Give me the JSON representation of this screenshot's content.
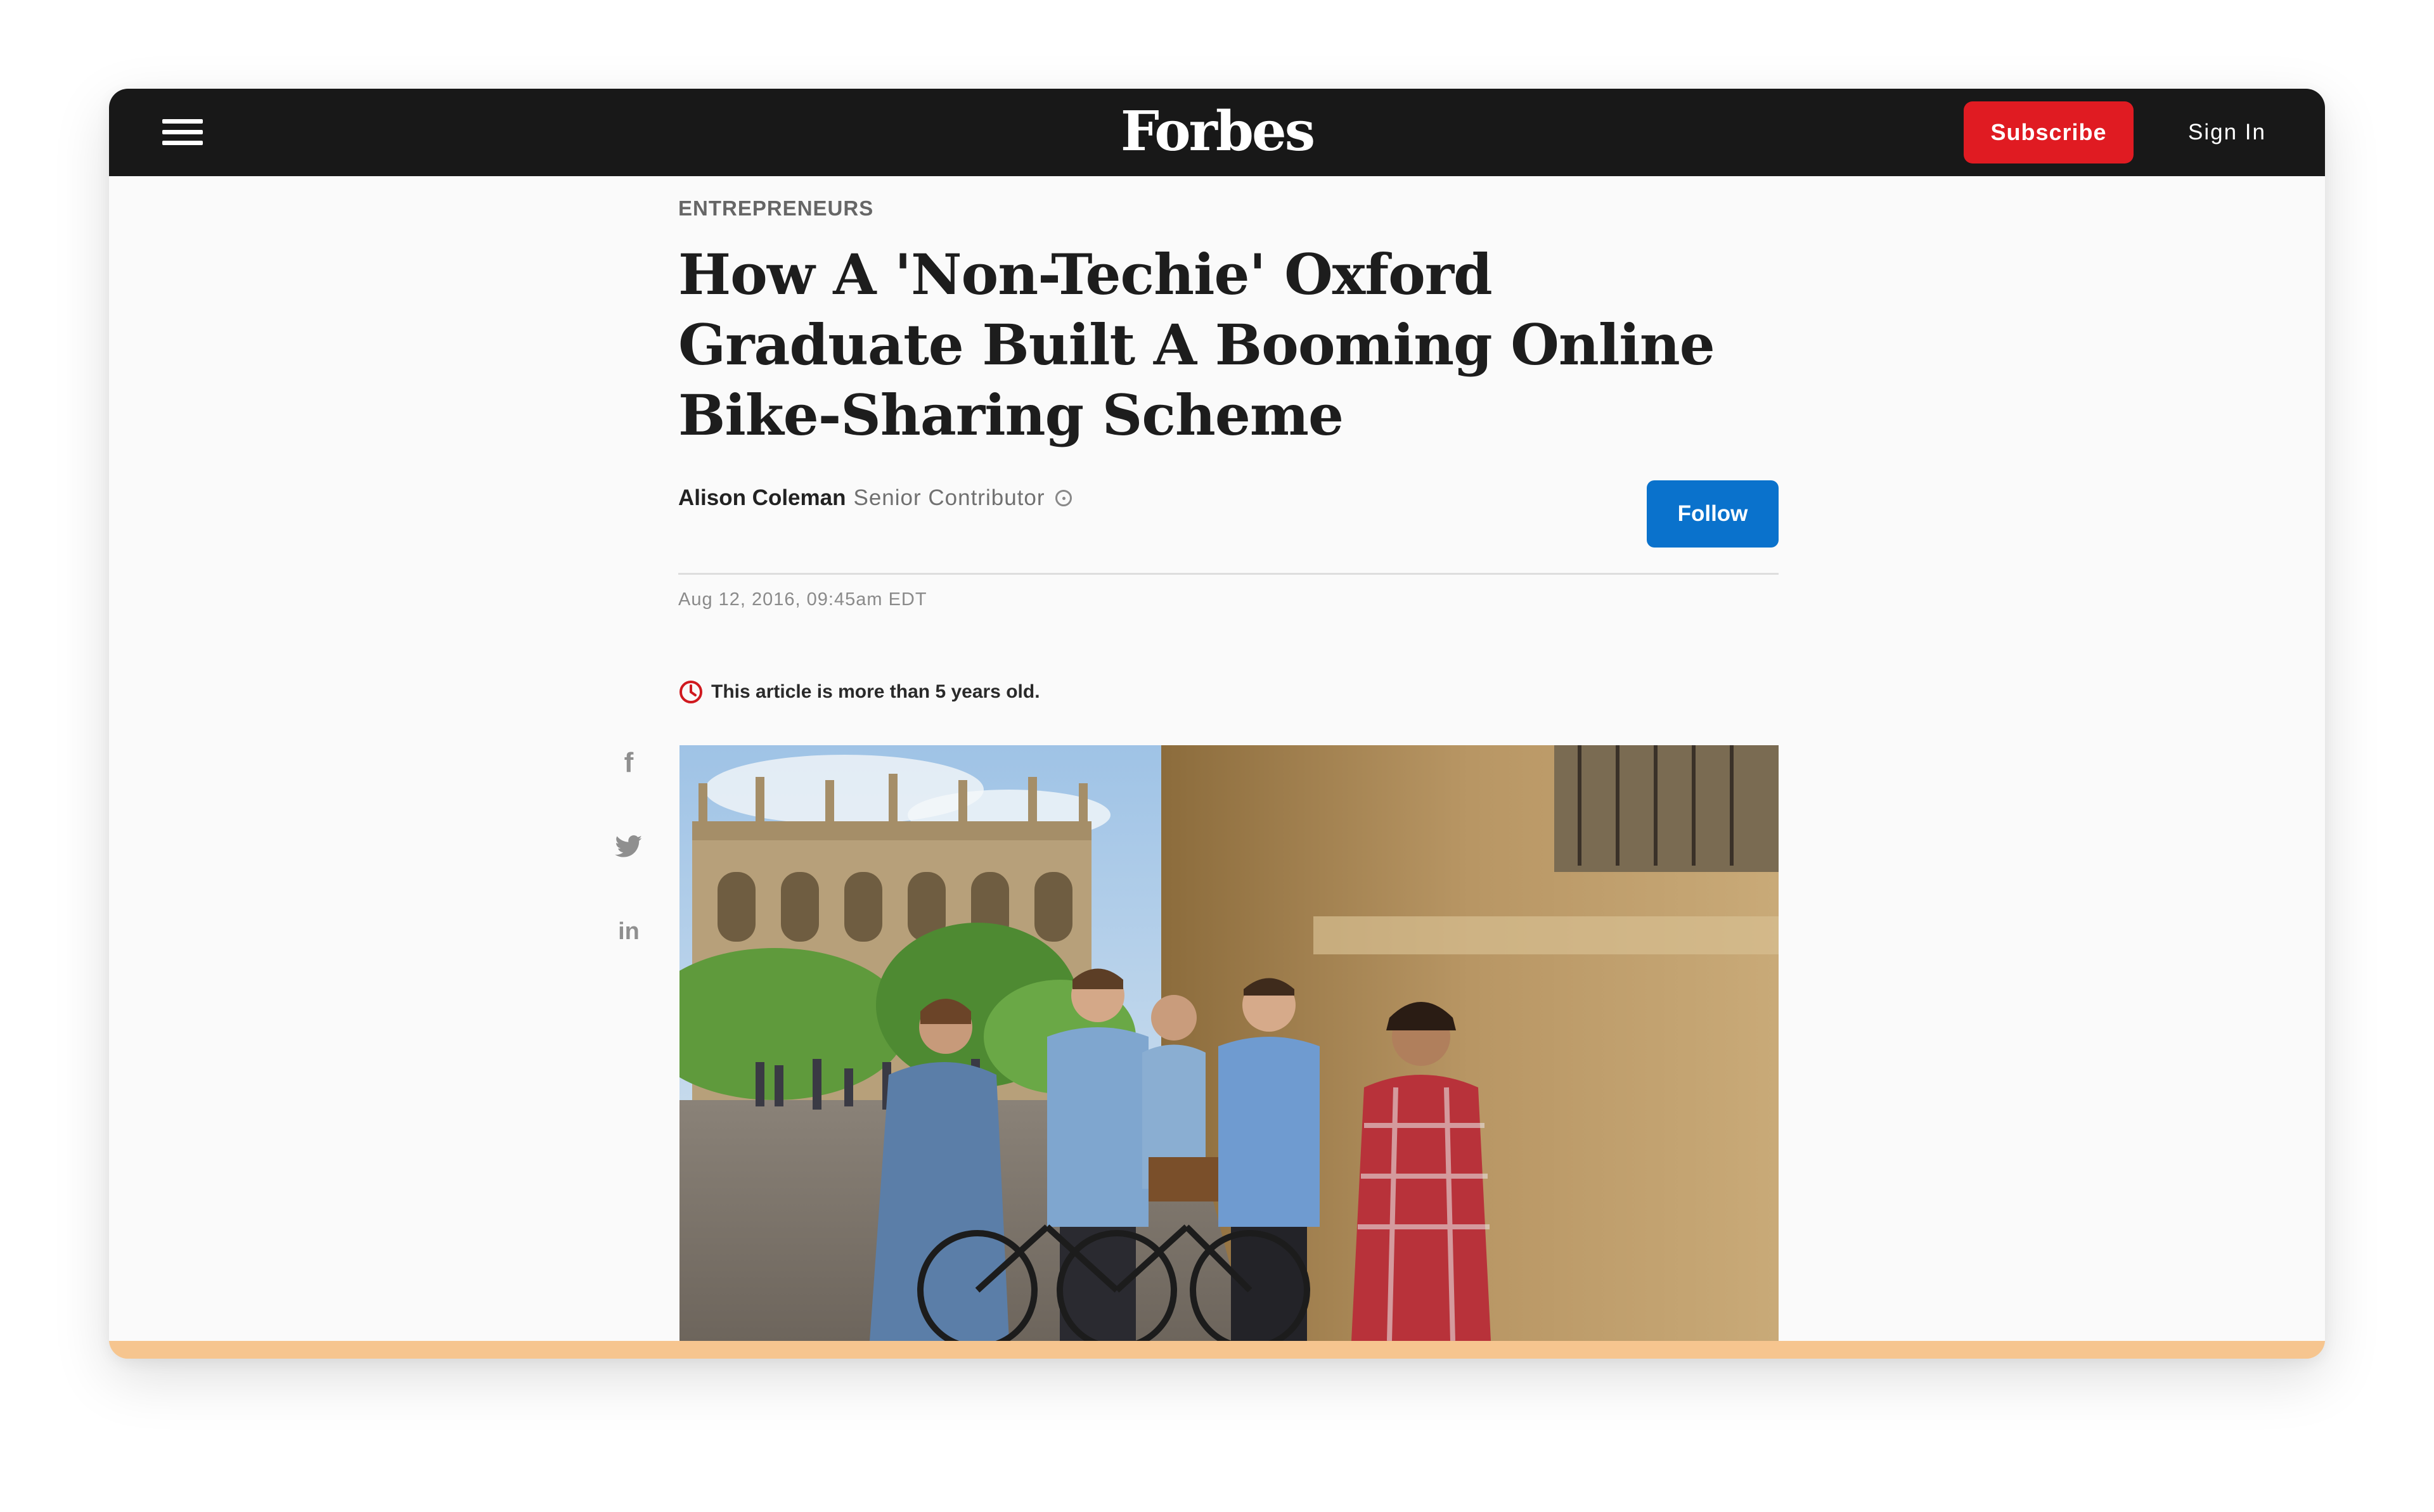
{
  "header": {
    "logo": "Forbes",
    "subscribe_label": "Subscribe",
    "signin_label": "Sign In"
  },
  "article": {
    "category": "ENTREPRENEURS",
    "headline": "How A 'Non-Techie' Oxford Graduate Built A Booming Online Bike-Sharing Scheme",
    "author": "Alison Coleman",
    "author_role": "Senior Contributor",
    "follow_label": "Follow",
    "dateline": "Aug 12, 2016, 09:45am EDT",
    "age_notice": "This article is more than 5 years old."
  },
  "share": {
    "facebook_glyph": "f",
    "linkedin_glyph": "in"
  },
  "icons": {
    "menu": "hamburger-menu-icon",
    "info": "info-icon",
    "clock": "clock-icon",
    "facebook": "facebook-icon",
    "twitter": "twitter-icon",
    "linkedin": "linkedin-icon"
  },
  "colors": {
    "topbar": "#181818",
    "subscribe": "#e01b22",
    "follow": "#0a72cc",
    "age_notice_icon": "#d0191f",
    "progress": "#f6c58f"
  },
  "reading_progress": 1.0
}
